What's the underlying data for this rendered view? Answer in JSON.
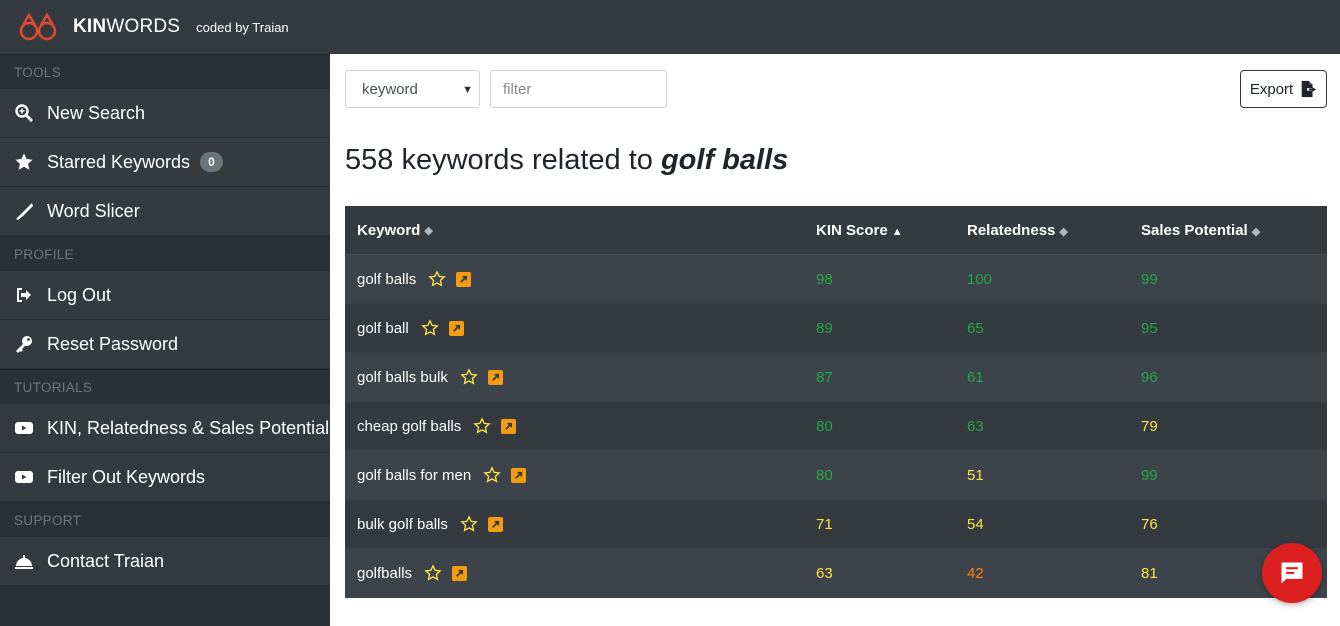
{
  "header": {
    "brand_bold": "KIN",
    "brand_light": "WORDS",
    "coded_by": "coded by Traian"
  },
  "sidebar": {
    "sections": [
      {
        "title": "TOOLS",
        "items": [
          {
            "label": "New Search",
            "icon": "search-plus-icon"
          },
          {
            "label": "Starred Keywords",
            "icon": "star-icon",
            "badge": "0"
          },
          {
            "label": "Word Slicer",
            "icon": "knife-icon"
          }
        ]
      },
      {
        "title": "PROFILE",
        "items": [
          {
            "label": "Log Out",
            "icon": "sign-out-icon"
          },
          {
            "label": "Reset Password",
            "icon": "key-icon"
          }
        ]
      },
      {
        "title": "TUTORIALS",
        "items": [
          {
            "label": "KIN, Relatedness & Sales Potential",
            "icon": "youtube-icon"
          },
          {
            "label": "Filter Out Keywords",
            "icon": "youtube-icon"
          }
        ]
      },
      {
        "title": "SUPPORT",
        "items": [
          {
            "label": "Contact Traian",
            "icon": "concierge-bell-icon"
          }
        ]
      }
    ]
  },
  "toolbar": {
    "select_value": "keyword",
    "filter_placeholder": "filter",
    "export_label": "Export"
  },
  "heading": {
    "prefix": "558 keywords related to ",
    "query": "golf balls"
  },
  "table": {
    "headers": {
      "keyword": "Keyword",
      "kin": "KIN Score",
      "relatedness": "Relatedness",
      "sales": "Sales Potential"
    },
    "rows": [
      {
        "keyword": "golf balls",
        "kin": "98",
        "kin_c": "g",
        "rel": "100",
        "rel_c": "g",
        "sales": "99",
        "sales_c": "g"
      },
      {
        "keyword": "golf ball",
        "kin": "89",
        "kin_c": "g",
        "rel": "65",
        "rel_c": "g",
        "sales": "95",
        "sales_c": "g"
      },
      {
        "keyword": "golf balls bulk",
        "kin": "87",
        "kin_c": "g",
        "rel": "61",
        "rel_c": "g",
        "sales": "96",
        "sales_c": "g"
      },
      {
        "keyword": "cheap golf balls",
        "kin": "80",
        "kin_c": "g",
        "rel": "63",
        "rel_c": "g",
        "sales": "79",
        "sales_c": "y"
      },
      {
        "keyword": "golf balls for men",
        "kin": "80",
        "kin_c": "g",
        "rel": "51",
        "rel_c": "y",
        "sales": "99",
        "sales_c": "g"
      },
      {
        "keyword": "bulk golf balls",
        "kin": "71",
        "kin_c": "y",
        "rel": "54",
        "rel_c": "y",
        "sales": "76",
        "sales_c": "y"
      },
      {
        "keyword": "golfballs",
        "kin": "63",
        "kin_c": "y",
        "rel": "42",
        "rel_c": "o",
        "sales": "81",
        "sales_c": "y"
      }
    ]
  },
  "colors": {
    "accent_orange": "#f39c12",
    "score_green": "#28a745",
    "score_yellow": "#ffe342",
    "score_orange": "#fd7e14",
    "chat_red": "#dc1f1f"
  }
}
